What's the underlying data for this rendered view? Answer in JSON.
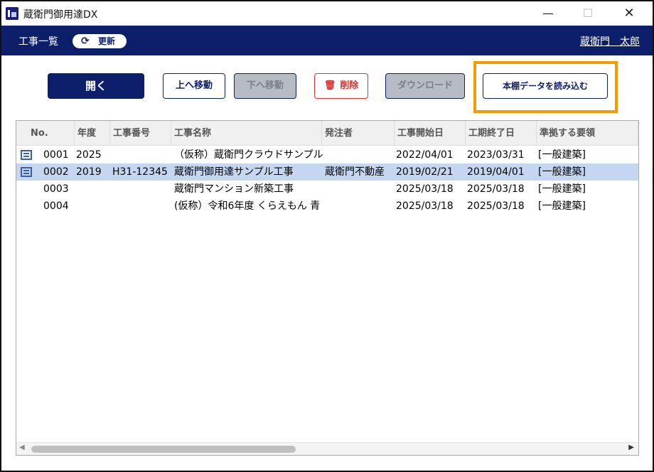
{
  "window": {
    "title": "蔵衛門御用達DX",
    "minimize_glyph": "—",
    "maximize_glyph": "☐",
    "close_glyph": "✕"
  },
  "header": {
    "title": "工事一覧",
    "refresh_label": "更新",
    "refresh_icon": "⟳",
    "user_name": "蔵衛門　太郎"
  },
  "toolbar": {
    "open_label": "開く",
    "move_up_label": "上へ移動",
    "move_down_label": "下へ移動",
    "delete_label": "削除",
    "delete_icon": "🗑",
    "download_label": "ダウンロード",
    "import_label": "本棚データを読み込む"
  },
  "table": {
    "columns": [
      "No.",
      "年度",
      "工事番号",
      "工事名称",
      "発注者",
      "工事開始日",
      "工期終了日",
      "準拠する要領"
    ],
    "rows": [
      {
        "no": "0001",
        "year": "2025",
        "number": "",
        "name": "（仮称）蔵衛門クラウドサンプル新",
        "client": "",
        "start": "2022/04/01",
        "end": "2023/03/31",
        "standard": "[一般建築]",
        "has_icon": true,
        "selected": false
      },
      {
        "no": "0002",
        "year": "2019",
        "number": "H31-12345",
        "name": "蔵衛門御用達サンプル工事",
        "client": "蔵衛門不動産",
        "start": "2019/02/21",
        "end": "2019/04/01",
        "standard": "[一般建築]",
        "has_icon": true,
        "selected": true
      },
      {
        "no": "0003",
        "year": "",
        "number": "",
        "name": "蔵衛門マンション新築工事",
        "client": "",
        "start": "2025/03/18",
        "end": "2025/03/18",
        "standard": "[一般建築]",
        "has_icon": false,
        "selected": false
      },
      {
        "no": "0004",
        "year": "",
        "number": "",
        "name": "(仮称）令和6年度 くらえもん 青",
        "client": "",
        "start": "2025/03/18",
        "end": "2025/03/18",
        "standard": "[一般建築]",
        "has_icon": false,
        "selected": false
      }
    ]
  },
  "colors": {
    "navy": "#0d1f6b",
    "highlight": "#f59b00",
    "selected_row": "#c5d6f0",
    "delete_red": "#e03030"
  }
}
